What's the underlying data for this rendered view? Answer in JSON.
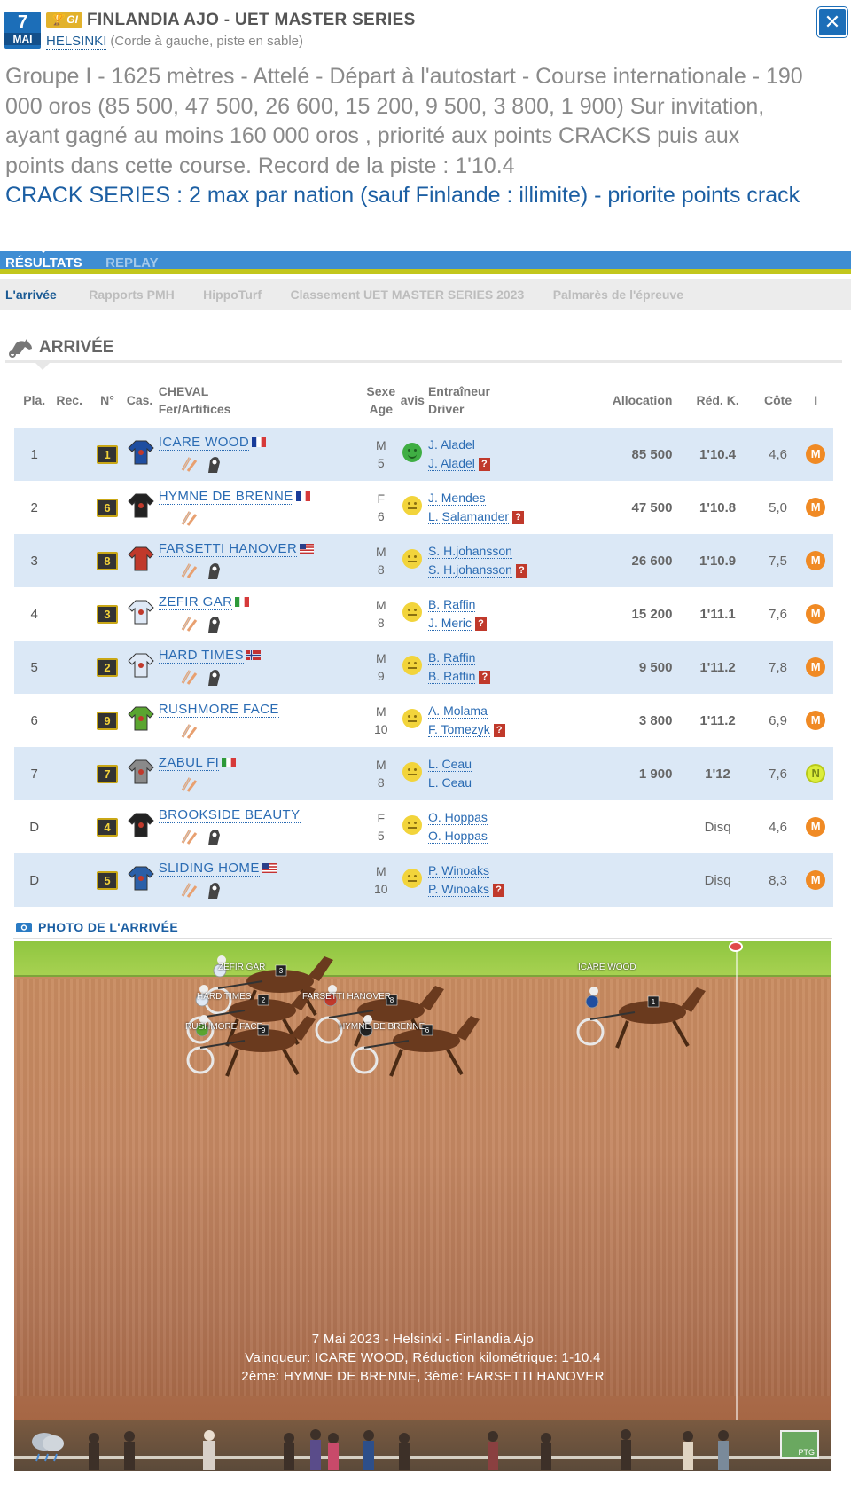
{
  "header": {
    "date_day": "7",
    "date_month": "MAI",
    "grade_badge": "GI",
    "title": "FINLANDIA AJO - UET MASTER SERIES",
    "venue": "HELSINKI",
    "venue_detail": "(Corde à gauche, piste en sable)",
    "description": "Groupe I - 1625 mètres - Attelé - Départ à l'autostart - Course internationale - 190 000 oros (85 500, 47 500, 26 600, 15 200, 9 500, 3 800, 1 900) Sur invitation, ayant gagné au moins 160 000 oros , priorité aux points CRACKS puis aux points dans cette course. Record de la piste : 1'10.4",
    "crack_note": "CRACK SERIES : 2 max par nation (sauf Finlande : illimite) - priorite points crack"
  },
  "tabs": [
    {
      "label": "RÉSULTATS"
    },
    {
      "label": "REPLAY"
    }
  ],
  "subtabs": [
    {
      "label": "L'arrivée"
    },
    {
      "label": "Rapports PMH"
    },
    {
      "label": "HippoTurf"
    },
    {
      "label": "Classement UET MASTER SERIES 2023"
    },
    {
      "label": "Palmarès de l'épreuve"
    }
  ],
  "section": {
    "title": "ARRIVÉE"
  },
  "table": {
    "headers": {
      "pla": "Pla.",
      "rec": "Rec.",
      "num": "N°",
      "cas": "Cas.",
      "cheval": "CHEVAL",
      "fer": "Fer/Artifices",
      "sexe": "Sexe",
      "age": "Age",
      "avis": "avis",
      "entraineur": "Entraîneur",
      "driver": "Driver",
      "allocation": "Allocation",
      "red": "Réd. K.",
      "cote": "Côte",
      "i": "I"
    },
    "rows": [
      {
        "pla": "1",
        "num": "1",
        "name": "ICARE WOOD",
        "flag": "fr",
        "sexe": "M",
        "age": "5",
        "avis": "green",
        "trainer": "J. Aladel",
        "driver": "J. Aladel",
        "driver_q": "?",
        "alloc": "85 500",
        "red": "1'10.4",
        "cote": "4,6",
        "i": "M",
        "shirt": "#1f4ea0",
        "hood": true
      },
      {
        "pla": "2",
        "num": "6",
        "name": "HYMNE DE BRENNE",
        "flag": "fr",
        "sexe": "F",
        "age": "6",
        "avis": "yellow",
        "trainer": "J. Mendes",
        "driver": "L. Salamander",
        "driver_q": "?",
        "alloc": "47 500",
        "red": "1'10.8",
        "cote": "5,0",
        "i": "M",
        "shirt": "#222222",
        "hood": false
      },
      {
        "pla": "3",
        "num": "8",
        "name": "FARSETTI HANOVER",
        "flag": "us",
        "sexe": "M",
        "age": "8",
        "avis": "yellow",
        "trainer": "S. H.johansson",
        "driver": "S. H.johansson",
        "driver_q": "?",
        "alloc": "26 600",
        "red": "1'10.9",
        "cote": "7,5",
        "i": "M",
        "shirt": "#c0392b",
        "hood": true
      },
      {
        "pla": "4",
        "num": "3",
        "name": "ZEFIR GAR",
        "flag": "it",
        "sexe": "M",
        "age": "8",
        "avis": "yellow",
        "trainer": "B. Raffin",
        "driver": "J. Meric",
        "driver_q": "?",
        "alloc": "15 200",
        "red": "1'11.1",
        "cote": "7,6",
        "i": "M",
        "shirt": "#dfe9f6",
        "hood": true
      },
      {
        "pla": "5",
        "num": "2",
        "name": "HARD TIMES",
        "flag": "no",
        "sexe": "M",
        "age": "9",
        "avis": "yellow",
        "trainer": "B. Raffin",
        "driver": "B. Raffin",
        "driver_q": "?",
        "alloc": "9 500",
        "red": "1'11.2",
        "cote": "7,8",
        "i": "M",
        "shirt": "#dfe9f6",
        "hood": true
      },
      {
        "pla": "6",
        "num": "9",
        "name": "RUSHMORE FACE",
        "flag": "",
        "sexe": "M",
        "age": "10",
        "avis": "yellow",
        "trainer": "A. Molama",
        "driver": "F. Tomezyk",
        "driver_q": "?",
        "alloc": "3 800",
        "red": "1'11.2",
        "cote": "6,9",
        "i": "M",
        "shirt": "#5aa530",
        "hood": false
      },
      {
        "pla": "7",
        "num": "7",
        "name": "ZABUL FI",
        "flag": "it",
        "sexe": "M",
        "age": "8",
        "avis": "yellow",
        "trainer": "L. Ceau",
        "driver": "L. Ceau",
        "driver_q": "",
        "alloc": "1 900",
        "red": "1'12",
        "cote": "7,6",
        "i": "N",
        "shirt": "#8a8a8a",
        "hood": false
      },
      {
        "pla": "D",
        "num": "4",
        "name": "BROOKSIDE BEAUTY",
        "flag": "",
        "sexe": "F",
        "age": "5",
        "avis": "yellow",
        "trainer": "O. Hoppas",
        "driver": "O. Hoppas",
        "driver_q": "",
        "alloc": "",
        "red": "Disq",
        "cote": "4,6",
        "i": "M",
        "shirt": "#222222",
        "hood": true
      },
      {
        "pla": "D",
        "num": "5",
        "name": "SLIDING HOME",
        "flag": "us",
        "sexe": "M",
        "age": "10",
        "avis": "yellow",
        "trainer": "P. Winoaks",
        "driver": "P. Winoaks",
        "driver_q": "?",
        "alloc": "",
        "red": "Disq",
        "cote": "8,3",
        "i": "M",
        "shirt": "#2a5fa8",
        "hood": true
      }
    ]
  },
  "photo": {
    "section_title": "PHOTO DE L'ARRIVÉE",
    "caption_line1": "7 Mai 2023 - Helsinki - Finlandia Ajo",
    "caption_line2": "Vainqueur: ICARE WOOD, Réduction kilométrique: 1-10.4",
    "caption_line3": "2ème: HYMNE DE BRENNE, 3ème: FARSETTI HANOVER",
    "horse_labels": [
      "ZEFIR GAR",
      "HARD TIMES",
      "RUSHMORE FACE",
      "FARSETTI HANOVER",
      "HYMNE DE BRENNE",
      "ICARE WOOD"
    ],
    "logo_text": "PTG"
  },
  "colors": {
    "primary_blue": "#3f8dd3",
    "accent_yellow": "#c2c61c",
    "link_blue": "#2a6bb3",
    "row_blue": "#dbe8f6"
  }
}
